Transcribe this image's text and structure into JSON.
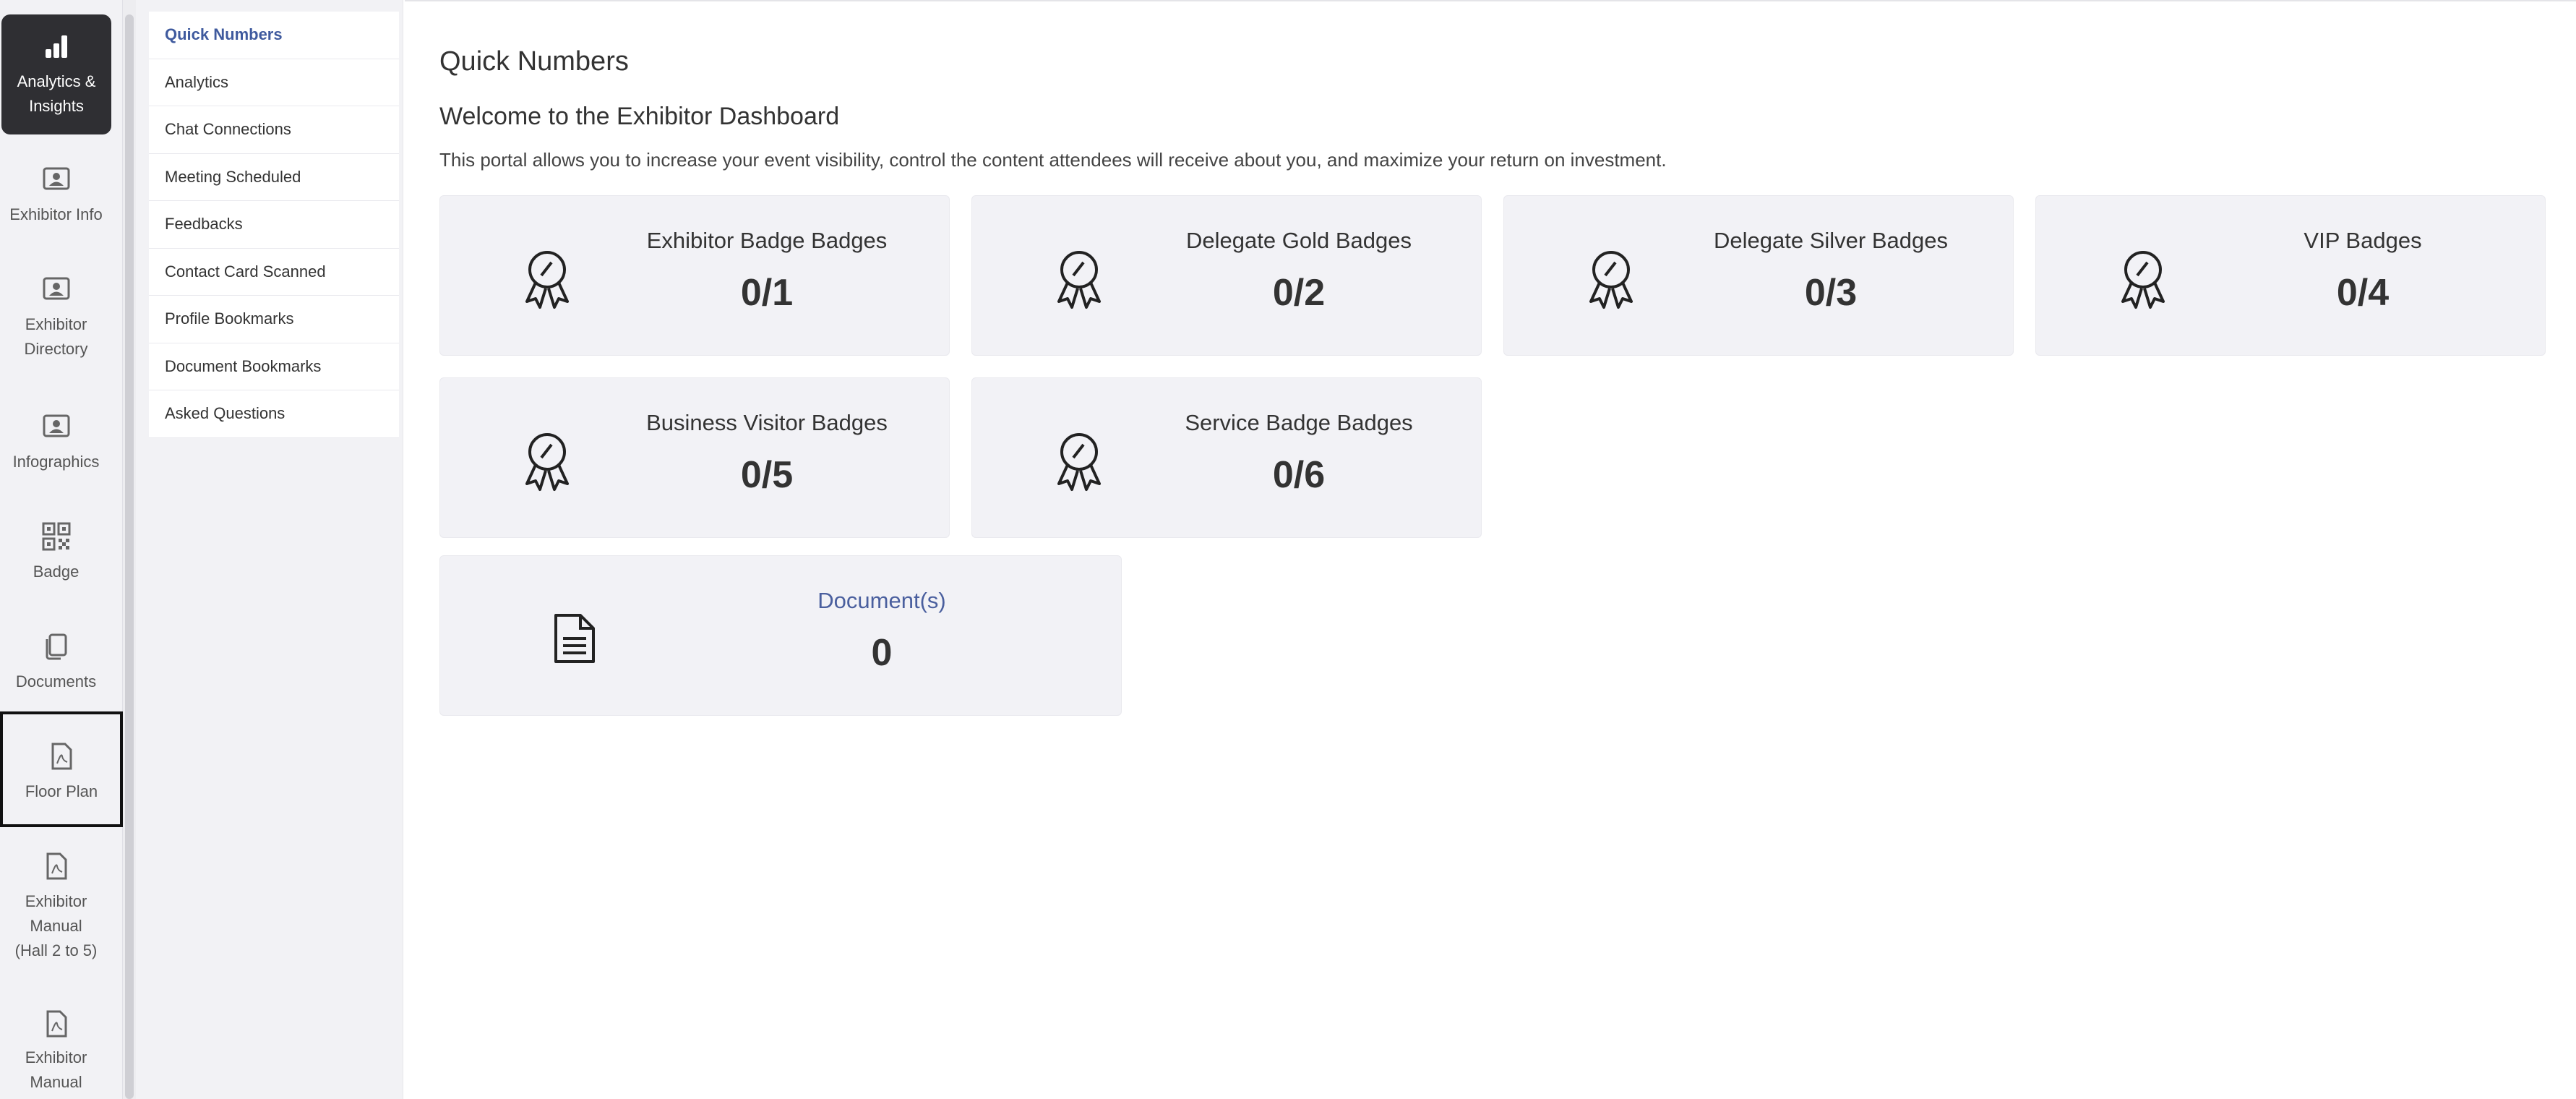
{
  "rail": {
    "items": [
      {
        "label": "Analytics & Insights",
        "icon": "bar-chart-icon"
      },
      {
        "label": "Exhibitor Info",
        "icon": "id-card-icon"
      },
      {
        "label": "Exhibitor Directory",
        "icon": "id-card-icon"
      },
      {
        "label": "Infographics",
        "icon": "id-card-icon"
      },
      {
        "label": "Badge",
        "icon": "qr-code-icon"
      },
      {
        "label": "Documents",
        "icon": "copy-icon"
      },
      {
        "label": "Floor Plan",
        "icon": "pdf-file-icon"
      },
      {
        "label": "Exhibitor Manual (Hall 2 to 5)",
        "icon": "pdf-file-icon"
      },
      {
        "label": "Exhibitor Manual (Hall",
        "icon": "pdf-file-icon"
      }
    ]
  },
  "submenu": {
    "items": [
      "Quick Numbers",
      "Analytics",
      "Chat Connections",
      "Meeting Scheduled",
      "Feedbacks",
      "Contact Card Scanned",
      "Profile Bookmarks",
      "Document Bookmarks",
      "Asked Questions"
    ]
  },
  "main": {
    "title": "Quick Numbers",
    "welcome": "Welcome to the Exhibitor Dashboard",
    "description": "This portal allows you to increase your event visibility, control the content attendees will receive about you, and maximize your return on investment.",
    "cards": [
      {
        "label": "Exhibitor Badge Badges",
        "value": "0/1",
        "icon": "award-ribbon-icon"
      },
      {
        "label": "Delegate Gold Badges",
        "value": "0/2",
        "icon": "award-ribbon-icon"
      },
      {
        "label": "Delegate Silver Badges",
        "value": "0/3",
        "icon": "award-ribbon-icon"
      },
      {
        "label": "VIP Badges",
        "value": "0/4",
        "icon": "award-ribbon-icon"
      },
      {
        "label": "Business Visitor Badges",
        "value": "0/5",
        "icon": "award-ribbon-icon"
      },
      {
        "label": "Service Badge Badges",
        "value": "0/6",
        "icon": "award-ribbon-icon"
      }
    ],
    "documents_card": {
      "label": "Document(s)",
      "value": "0",
      "icon": "document-icon"
    }
  }
}
